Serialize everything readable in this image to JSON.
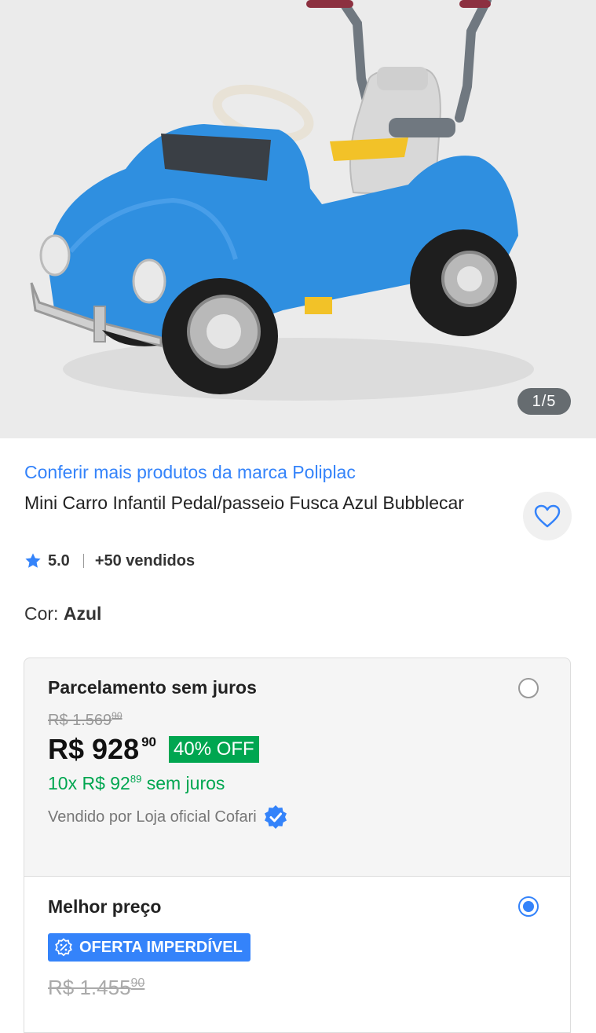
{
  "gallery": {
    "counter": "1/5",
    "image_alt": "Mini Carro Infantil Pedal/passeio Fusca Azul Bubblecar"
  },
  "product": {
    "brand_link": "Conferir mais produtos da marca Poliplac",
    "title": "Mini Carro Infantil Pedal/passeio Fusca Azul Bubblecar",
    "rating": "5.0",
    "sold": "+50 vendidos",
    "favorite_icon": "heart-outline-icon"
  },
  "variant": {
    "label": "Cor:",
    "value": "Azul"
  },
  "purchase_options": [
    {
      "title": "Parcelamento sem juros",
      "selected": false,
      "old_price_int": "R$ 1.569",
      "old_price_cents": "90",
      "price_int": "R$ 928",
      "price_cents": "90",
      "discount": "40% OFF",
      "installments_prefix": "10x R$ 92",
      "installments_cents": "89",
      "installments_suffix": " sem juros",
      "seller": "Vendido por Loja oficial Cofari"
    },
    {
      "title": "Melhor preço",
      "selected": true,
      "badge": "OFERTA IMPERDÍVEL",
      "old_price_int": "R$ 1.455",
      "old_price_cents": "90"
    }
  ],
  "colors": {
    "accent": "#3483fa",
    "success": "#00a650",
    "car_blue": "#2f8fe0"
  }
}
